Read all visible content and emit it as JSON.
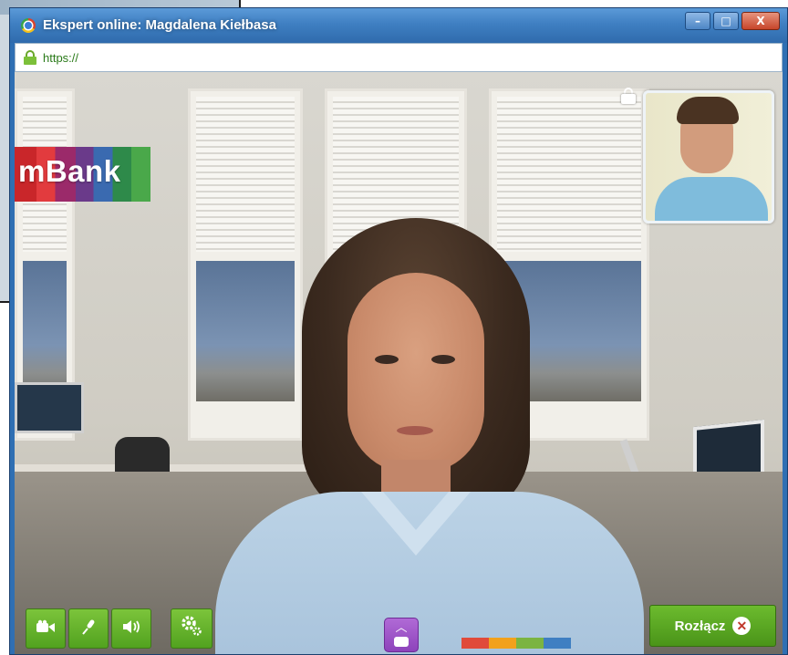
{
  "window": {
    "title": "Ekspert online: Magdalena Kiełbasa",
    "controls": {
      "minimize": "–",
      "maximize": "□",
      "close": "X"
    }
  },
  "address": {
    "url": "https://"
  },
  "video": {
    "logo_text": "mBank",
    "icons": {
      "self_view_lock": "lock-icon",
      "camera": "camera-icon",
      "microphone": "microphone-icon",
      "speaker": "speaker-icon",
      "settings": "gear-icon",
      "chat": "chat-bubble-icon",
      "hangup": "close-circle-icon"
    },
    "hangup_label": "Rozłącz"
  },
  "colors": {
    "title_bar": "#3f7fc2",
    "control_green": "#52a21f",
    "chat_purple": "#8d43bb",
    "lock_green": "#7cc03a"
  }
}
